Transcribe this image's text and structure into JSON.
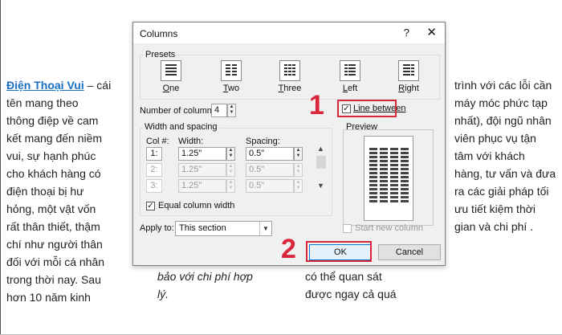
{
  "background": {
    "left_column": {
      "link": "Điện Thoại Vui",
      "first_line_rest": " – cái",
      "lines": [
        "tên mang theo",
        "thông điệp về cam",
        "kết mang đến niềm",
        "vui, sự hạnh phúc",
        "cho khách hàng có",
        "điện thoại bị hư",
        "hỏng, một vật vốn",
        "rất thân thiết, thậm",
        "chí như người thân",
        "đối với mỗi cá nhân",
        "trong thời nay. Sau",
        "hơn 10 năm kinh"
      ]
    },
    "right_column": {
      "lines": [
        "trình với các lỗi cần",
        "máy móc phức tạp",
        "nhất), đội ngũ nhân",
        "viên phục vụ tận",
        "tâm với khách",
        "hàng, tư vấn và đưa",
        "ra các giải pháp tối",
        "ưu tiết kiệm thời",
        "gian và chi phí ."
      ]
    },
    "mid_column_1": {
      "lines": [
        "bảo với chi phí hợp",
        "lý."
      ]
    },
    "mid_column_2": {
      "lines": [
        "có thể quan sát",
        "được ngay cả quá"
      ]
    }
  },
  "dialog": {
    "title": "Columns",
    "help_label": "?",
    "close_label": "✕",
    "presets": {
      "label": "Presets",
      "items": [
        {
          "key": "O",
          "rest": "ne"
        },
        {
          "key": "T",
          "rest": "wo"
        },
        {
          "key": "T",
          "rest": "hree"
        },
        {
          "key": "L",
          "rest": "eft"
        },
        {
          "key": "R",
          "rest": "ight"
        }
      ]
    },
    "number_of_columns": {
      "label": "Number of columns:",
      "value": "4"
    },
    "line_between": {
      "label": "Line between",
      "checked": true
    },
    "preview_label": "Preview",
    "width_spacing": {
      "label": "Width and spacing",
      "col_header": "Col #:",
      "width_header": "Width:",
      "spacing_header": "Spacing:",
      "rows": [
        {
          "col": "1:",
          "width": "1.25\"",
          "spacing": "0.5\"",
          "enabled": true
        },
        {
          "col": "2:",
          "width": "1.25\"",
          "spacing": "0.5\"",
          "enabled": false
        },
        {
          "col": "3:",
          "width": "1.25\"",
          "spacing": "0.5\"",
          "enabled": false
        }
      ]
    },
    "equal_column_width": {
      "label": "Equal column width",
      "checked": true
    },
    "apply_to": {
      "label": "Apply to:",
      "value": "This section"
    },
    "start_new_column": {
      "label": "Start new column",
      "checked": false
    },
    "ok_label": "OK",
    "cancel_label": "Cancel"
  },
  "annotations": {
    "step1": "1",
    "step2": "2",
    "color": "#d9263a"
  },
  "preview_columns": 4
}
